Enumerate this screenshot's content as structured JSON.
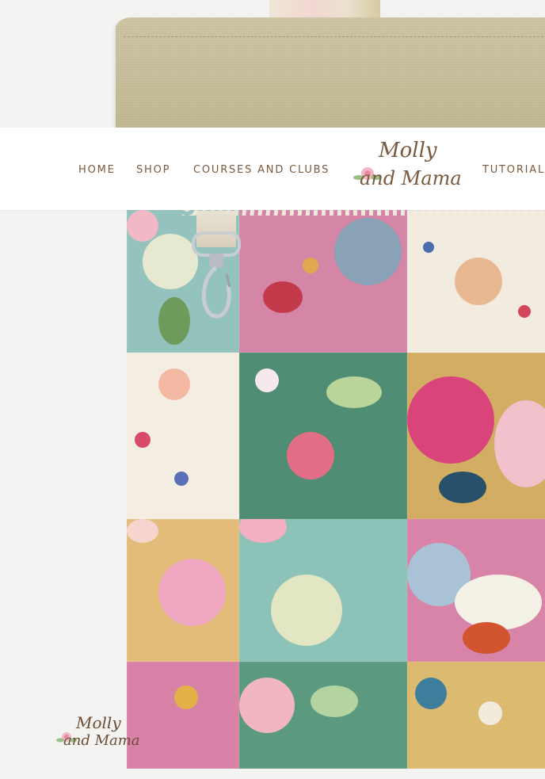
{
  "site": {
    "brand": {
      "line1": "Molly",
      "line2": "and Mama"
    }
  },
  "nav": {
    "items": [
      {
        "label": "HOME"
      },
      {
        "label": "SHOP"
      },
      {
        "label": "COURSES AND CLUBS"
      },
      {
        "label": "TUTORIALS"
      }
    ]
  },
  "watermark": {
    "line1": "Molly",
    "line2": "and Mama"
  },
  "colors": {
    "nav_text": "#7a5a3f",
    "linen": "#c8bf9c",
    "background": "#f3f3f1",
    "patch_pink": "#d77fa3",
    "patch_cream": "#f1ebdf",
    "patch_teal": "#8fbfb8",
    "patch_green": "#5f9a7e",
    "patch_mustard": "#d9b36a"
  }
}
